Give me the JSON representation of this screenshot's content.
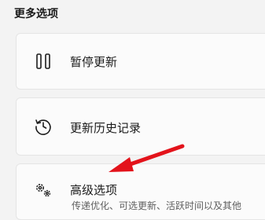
{
  "section": {
    "title": "更多选项"
  },
  "options": [
    {
      "label": "暂停更新",
      "icon": "pause-icon"
    },
    {
      "label": "更新历史记录",
      "icon": "history-icon"
    },
    {
      "label": "高级选项",
      "icon": "gears-icon",
      "description": "传递优化、可选更新、活跃时间以及其他"
    }
  ],
  "colors": {
    "accent_arrow": "#e3131b",
    "card_bg": "#fbfbfb",
    "page_bg": "#f3f3f3"
  }
}
